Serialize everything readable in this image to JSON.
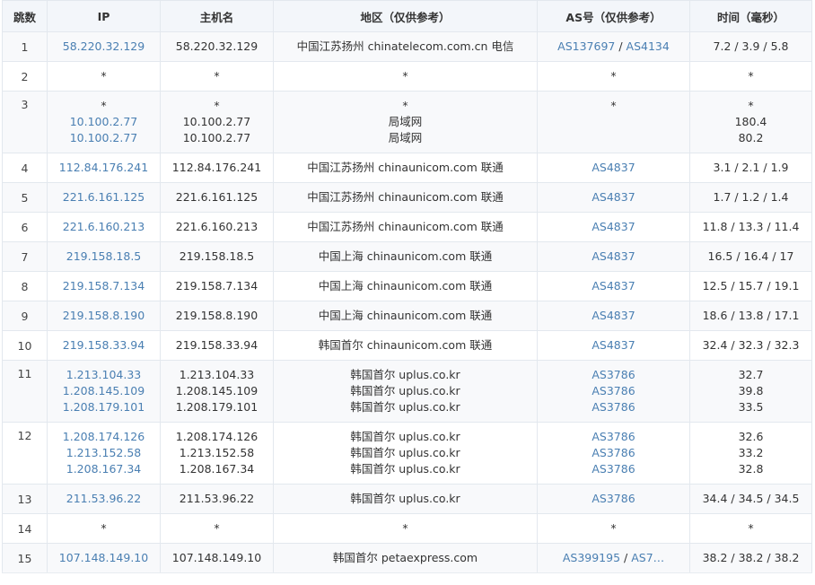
{
  "headers": {
    "hop": "跳数",
    "ip": "IP",
    "host": "主机名",
    "region": "地区（仅供参考）",
    "as": "AS号（仅供参考）",
    "time": "时间（毫秒）"
  },
  "rows": [
    {
      "hop": "1",
      "ip": [
        "58.220.32.129"
      ],
      "host": [
        "58.220.32.129"
      ],
      "region": [
        "中国江苏扬州 chinatelecom.com.cn 电信"
      ],
      "as": [
        [
          "AS137697",
          "AS4134"
        ]
      ],
      "time": [
        "7.2 / 3.9 / 5.8"
      ]
    },
    {
      "hop": "2",
      "ip": [
        "*"
      ],
      "host": [
        "*"
      ],
      "region": [
        "*"
      ],
      "as": [
        [
          "*"
        ]
      ],
      "time": [
        "*"
      ]
    },
    {
      "hop": "3",
      "ip": [
        "*",
        "10.100.2.77",
        "10.100.2.77"
      ],
      "host": [
        "*",
        "10.100.2.77",
        "10.100.2.77"
      ],
      "region": [
        "*",
        "局域网",
        "局域网"
      ],
      "as": [
        [
          "*"
        ]
      ],
      "time": [
        "*",
        "180.4",
        "80.2"
      ]
    },
    {
      "hop": "4",
      "ip": [
        "112.84.176.241"
      ],
      "host": [
        "112.84.176.241"
      ],
      "region": [
        "中国江苏扬州 chinaunicom.com 联通"
      ],
      "as": [
        [
          "AS4837"
        ]
      ],
      "time": [
        "3.1 / 2.1 / 1.9"
      ]
    },
    {
      "hop": "5",
      "ip": [
        "221.6.161.125"
      ],
      "host": [
        "221.6.161.125"
      ],
      "region": [
        "中国江苏扬州 chinaunicom.com 联通"
      ],
      "as": [
        [
          "AS4837"
        ]
      ],
      "time": [
        "1.7 / 1.2 / 1.4"
      ]
    },
    {
      "hop": "6",
      "ip": [
        "221.6.160.213"
      ],
      "host": [
        "221.6.160.213"
      ],
      "region": [
        "中国江苏扬州 chinaunicom.com 联通"
      ],
      "as": [
        [
          "AS4837"
        ]
      ],
      "time": [
        "11.8 / 13.3 / 11.4"
      ]
    },
    {
      "hop": "7",
      "ip": [
        "219.158.18.5"
      ],
      "host": [
        "219.158.18.5"
      ],
      "region": [
        "中国上海 chinaunicom.com 联通"
      ],
      "as": [
        [
          "AS4837"
        ]
      ],
      "time": [
        "16.5 / 16.4 / 17"
      ]
    },
    {
      "hop": "8",
      "ip": [
        "219.158.7.134"
      ],
      "host": [
        "219.158.7.134"
      ],
      "region": [
        "中国上海 chinaunicom.com 联通"
      ],
      "as": [
        [
          "AS4837"
        ]
      ],
      "time": [
        "12.5 / 15.7 / 19.1"
      ]
    },
    {
      "hop": "9",
      "ip": [
        "219.158.8.190"
      ],
      "host": [
        "219.158.8.190"
      ],
      "region": [
        "中国上海 chinaunicom.com 联通"
      ],
      "as": [
        [
          "AS4837"
        ]
      ],
      "time": [
        "18.6 / 13.8 / 17.1"
      ]
    },
    {
      "hop": "10",
      "ip": [
        "219.158.33.94"
      ],
      "host": [
        "219.158.33.94"
      ],
      "region": [
        "韩国首尔 chinaunicom.com 联通"
      ],
      "as": [
        [
          "AS4837"
        ]
      ],
      "time": [
        "32.4 / 32.3 / 32.3"
      ]
    },
    {
      "hop": "11",
      "ip": [
        "1.213.104.33",
        "1.208.145.109",
        "1.208.179.101"
      ],
      "host": [
        "1.213.104.33",
        "1.208.145.109",
        "1.208.179.101"
      ],
      "region": [
        "韩国首尔 uplus.co.kr",
        "韩国首尔 uplus.co.kr",
        "韩国首尔 uplus.co.kr"
      ],
      "as": [
        [
          "AS3786"
        ],
        [
          "AS3786"
        ],
        [
          "AS3786"
        ]
      ],
      "time": [
        "32.7",
        "39.8",
        "33.5"
      ]
    },
    {
      "hop": "12",
      "ip": [
        "1.208.174.126",
        "1.213.152.58",
        "1.208.167.34"
      ],
      "host": [
        "1.208.174.126",
        "1.213.152.58",
        "1.208.167.34"
      ],
      "region": [
        "韩国首尔 uplus.co.kr",
        "韩国首尔 uplus.co.kr",
        "韩国首尔 uplus.co.kr"
      ],
      "as": [
        [
          "AS3786"
        ],
        [
          "AS3786"
        ],
        [
          "AS3786"
        ]
      ],
      "time": [
        "32.6",
        "33.2",
        "32.8"
      ]
    },
    {
      "hop": "13",
      "ip": [
        "211.53.96.22"
      ],
      "host": [
        "211.53.96.22"
      ],
      "region": [
        "韩国首尔 uplus.co.kr"
      ],
      "as": [
        [
          "AS3786"
        ]
      ],
      "time": [
        "34.4 / 34.5 / 34.5"
      ]
    },
    {
      "hop": "14",
      "ip": [
        "*"
      ],
      "host": [
        "*"
      ],
      "region": [
        "*"
      ],
      "as": [
        [
          "*"
        ]
      ],
      "time": [
        "*"
      ]
    },
    {
      "hop": "15",
      "ip": [
        "107.148.149.10"
      ],
      "host": [
        "107.148.149.10"
      ],
      "region": [
        "韩国首尔 petaexpress.com"
      ],
      "as": [
        [
          "AS399195",
          "AS7…"
        ]
      ],
      "time": [
        "38.2 / 38.2 / 38.2"
      ]
    }
  ],
  "colors": {
    "link": "#4a7fb2",
    "header_bg": "#f3f6fa",
    "odd_row_bg": "#f8f9fb",
    "border": "#e3e8ee"
  }
}
